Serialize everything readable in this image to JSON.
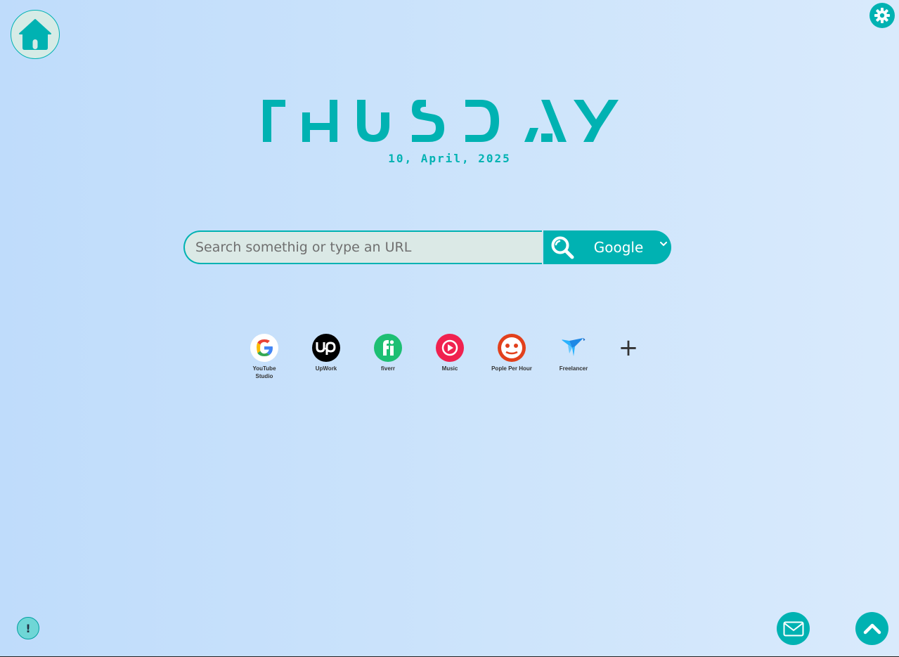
{
  "header": {
    "day_name": "THUSDAY",
    "date": "10, April, 2025"
  },
  "search": {
    "placeholder": "Search somethig or type an URL",
    "engine": "Google"
  },
  "shortcuts": [
    {
      "label": "YouTube Studio",
      "icon": "google-logo-icon"
    },
    {
      "label": "UpWork",
      "icon": "upwork-logo-icon"
    },
    {
      "label": "fiverr",
      "icon": "fiverr-logo-icon"
    },
    {
      "label": "Music",
      "icon": "music-play-icon"
    },
    {
      "label": "Pople Per Hour",
      "icon": "peopleperhour-logo-icon"
    },
    {
      "label": "Freelancer",
      "icon": "freelancer-bird-icon"
    }
  ],
  "add_shortcut_symbol": "+",
  "info_symbol": "!",
  "colors": {
    "accent": "#00b2b2",
    "background_left": "#bfdcfb",
    "background_right": "#d9eafc"
  }
}
